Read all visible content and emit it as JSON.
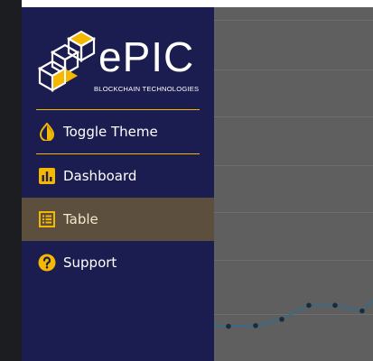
{
  "app": {
    "brand_name": "ePIC",
    "brand_tagline": "BLOCKCHAIN TECHNOLOGIES"
  },
  "colors": {
    "drawer_bg": "#1b1c4f",
    "accent": "#f5b800",
    "active_item_bg": "#5d4f3e",
    "overlay_bg": "#5f5f5f"
  },
  "nav": {
    "toggle_theme": {
      "label": "Toggle Theme",
      "icon": "contrast-drop-icon"
    },
    "items": [
      {
        "label": "Dashboard",
        "icon": "bar-chart-icon",
        "active": false
      },
      {
        "label": "Table",
        "icon": "table-list-icon",
        "active": true
      },
      {
        "label": "Support",
        "icon": "help-circle-icon",
        "active": false
      }
    ]
  },
  "background_chart": {
    "type": "line",
    "color": "#2e6d8e",
    "point_color": "#1a2b3a",
    "values": [
      32,
      31,
      31.5,
      36,
      46,
      46,
      42,
      58
    ]
  }
}
